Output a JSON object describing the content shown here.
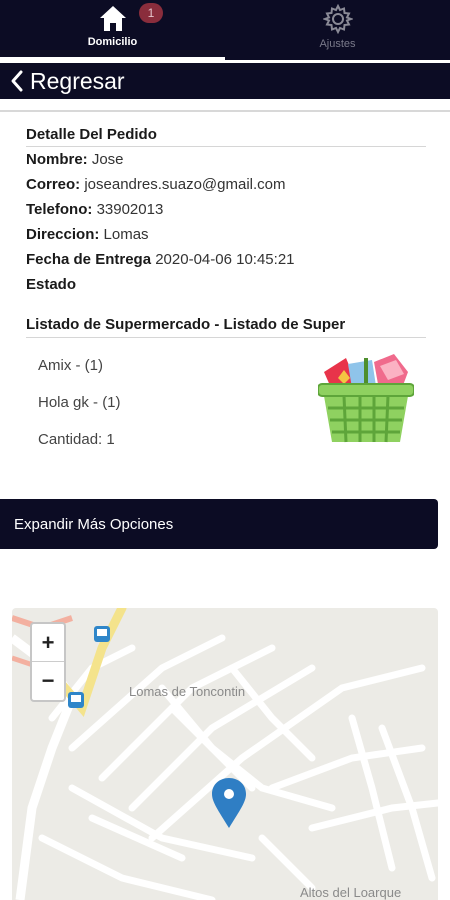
{
  "tabs": [
    {
      "label": "Domicilio",
      "badge": "1",
      "icon": "home-icon",
      "active": true
    },
    {
      "label": "Ajustes",
      "icon": "gear-icon",
      "active": false
    }
  ],
  "header": {
    "back_label": "Regresar",
    "icon": "chevron-left-icon"
  },
  "order": {
    "section_title": "Detalle Del Pedido",
    "fields": [
      {
        "key": "Nombre:",
        "value": "Jose"
      },
      {
        "key": "Correo:",
        "value": "joseandres.suazo@gmail.com"
      },
      {
        "key": "Telefono:",
        "value": "33902013"
      },
      {
        "key": "Direccion:",
        "value": "Lomas"
      },
      {
        "key": "Fecha de Entrega",
        "value": "2020-04-06 10:45:21"
      },
      {
        "key": "Estado",
        "value": ""
      }
    ]
  },
  "list": {
    "title": "Listado de Supermercado - Listado de Super",
    "items": [
      "Amix - (1)",
      "Hola gk - (1)",
      "Cantidad: 1"
    ],
    "image": "shopping-basket-icon"
  },
  "expand_button": "Expandir Más Opciones",
  "map": {
    "zoom_in": "+",
    "zoom_out": "−",
    "labels": [
      "Lomas de Toncontin",
      "Altos del Loarque"
    ],
    "colors": {
      "land": "#ecebe6",
      "road": "#ffffff",
      "highway": "#f4e38c",
      "pin": "#2f7ec4"
    }
  }
}
